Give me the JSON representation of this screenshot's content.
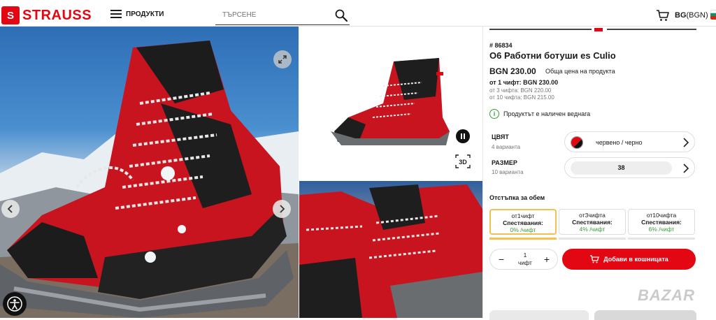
{
  "header": {
    "logo_text": "STRAUSS",
    "logo_mark": "S",
    "menu_label": "ПРОДУКТИ",
    "search_placeholder": "ТЪРСЕНЕ",
    "region_code": "BG",
    "region_currency": "(BGN)",
    "flag_colors": [
      "#ffffff",
      "#00966e",
      "#d62612"
    ]
  },
  "gallery": {
    "icons": [
      "expand-icon",
      "chevron-left-icon",
      "chevron-right-icon",
      "pause-icon",
      "3d-view-icon",
      "accessibility-icon"
    ],
    "three_d_label": "3D"
  },
  "product": {
    "sku": "# 86834",
    "title": "O6 Работни ботуши es Culio",
    "price": "BGN 230.00",
    "price_note": "Обща цена на продукта",
    "unit_price": "от 1 чифт: BGN 230.00",
    "tier_prices": [
      "от 3 чифта: BGN 220.00",
      "от 10 чифта: BGN 215.00"
    ],
    "availability": "Продуктът е наличен веднага",
    "color": {
      "label": "ЦВЯТ",
      "count": "4 варианта",
      "value": "червено / черно",
      "swatch_colors": [
        "#e30613",
        "#111111"
      ]
    },
    "size": {
      "label": "РАЗМЕР",
      "count": "10 варианта",
      "value": "38"
    },
    "volume_discount": {
      "title": "Отстъпка за обем",
      "tiers": [
        {
          "qty": "от1чифт",
          "label": "Спестявания:",
          "pct": "0% /чифт"
        },
        {
          "qty": "от3чифта",
          "label": "Спестявания:",
          "pct": "4% /чифт"
        },
        {
          "qty": "от10чифта",
          "label": "Спестявания:",
          "pct": "6% /чифт"
        }
      ]
    },
    "quantity": {
      "value": "1",
      "unit": "чифт",
      "minus": "−",
      "plus": "+"
    },
    "add_to_cart": "Добави в кошницата"
  },
  "watermark": "BAZAR",
  "colors": {
    "brand": "#e30613",
    "accent": "#f2c14e",
    "ok": "#3a9a3a"
  }
}
